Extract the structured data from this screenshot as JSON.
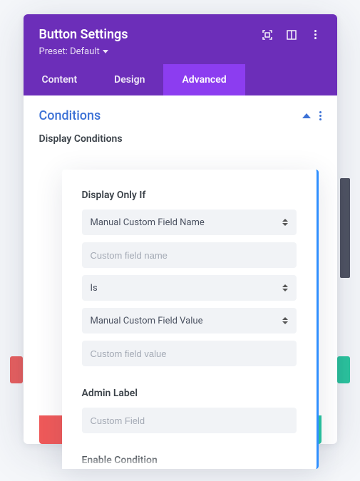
{
  "header": {
    "title": "Button Settings",
    "preset_label": "Preset: Default"
  },
  "tabs": {
    "content": "Content",
    "design": "Design",
    "advanced": "Advanced"
  },
  "section": {
    "title": "Conditions",
    "display_conditions_label": "Display Conditions"
  },
  "condition_editor": {
    "display_only_if_label": "Display Only If",
    "field_name_select": "Manual Custom Field Name",
    "field_name_placeholder": "Custom field name",
    "operator_select": "Is",
    "field_value_select": "Manual Custom Field Value",
    "field_value_placeholder": "Custom field value",
    "admin_label_label": "Admin Label",
    "admin_label_placeholder": "Custom Field",
    "enable_condition_label": "Enable Condition"
  }
}
